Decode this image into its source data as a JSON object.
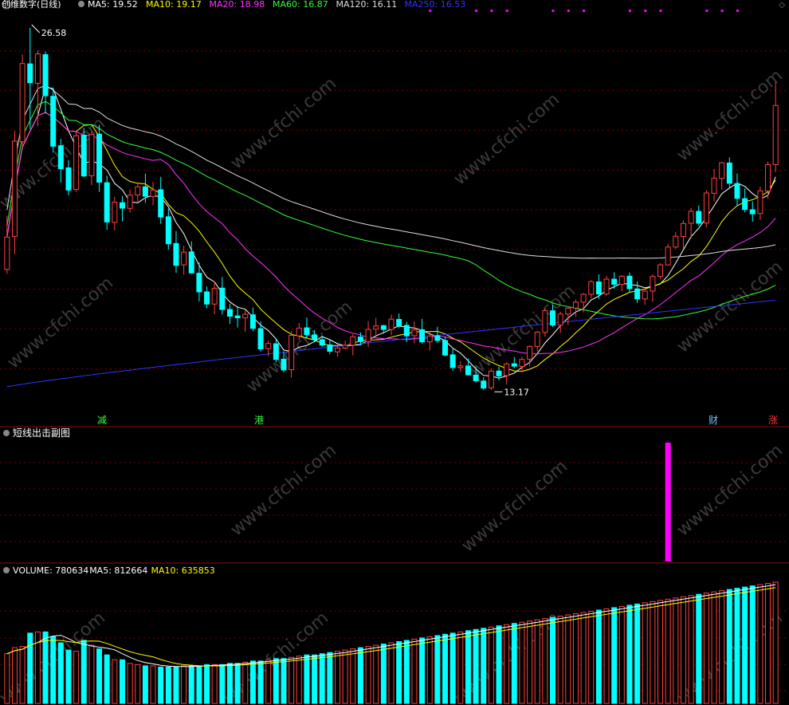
{
  "main_panel": {
    "title": "创维数字(日线)",
    "legend": [
      {
        "label": "MA5: 19.52",
        "color": "#ffffff"
      },
      {
        "label": "MA10: 19.17",
        "color": "#ffff00"
      },
      {
        "label": "MA20: 18.98",
        "color": "#ff33ff"
      },
      {
        "label": "MA60: 16.87",
        "color": "#33ff33"
      },
      {
        "label": "MA120: 16.11",
        "color": "#dddddd"
      },
      {
        "label": "MA250: 16.53",
        "color": "#3333ff"
      }
    ],
    "high_label": "26.58",
    "low_label": "13.17",
    "markers": [
      {
        "text": "减",
        "color": "#33ff33"
      },
      {
        "text": "港",
        "color": "#33ff33"
      },
      {
        "text": "财",
        "color": "#66ccff"
      },
      {
        "text": "涨",
        "color": "#ff3333"
      }
    ]
  },
  "sub_panel": {
    "title": "短线出击副图"
  },
  "volume_panel": {
    "legend": [
      {
        "label": "VOLUME: 780634",
        "color": "#ffffff"
      },
      {
        "label": "MA5: 812664",
        "color": "#ffffff"
      },
      {
        "label": "MA10: 635853",
        "color": "#ffff00"
      }
    ]
  },
  "colors": {
    "up": "#ff4040",
    "down": "#00ffff",
    "signal": "#ff00ff",
    "grid": "#7a0000",
    "separator": "#8a1010"
  },
  "watermark": "www.cfchi.com",
  "chart_data": {
    "type": "candlestick",
    "ylim": [
      12.5,
      27.2
    ],
    "ohlc": [
      [
        17.64,
        19.63,
        17.48,
        18.84
      ],
      [
        18.86,
        22.76,
        18.21,
        22.39
      ],
      [
        22.37,
        25.59,
        22.19,
        25.26
      ],
      [
        25.25,
        26.58,
        22.84,
        24.55
      ],
      [
        24.53,
        25.75,
        22.94,
        25.62
      ],
      [
        25.59,
        25.71,
        23.41,
        24.07
      ],
      [
        24.05,
        24.37,
        21.97,
        22.2
      ],
      [
        22.22,
        22.47,
        20.86,
        21.37
      ],
      [
        21.4,
        21.69,
        20.38,
        20.58
      ],
      [
        20.6,
        22.74,
        20.51,
        22.59
      ],
      [
        22.61,
        22.88,
        21.05,
        21.1
      ],
      [
        21.11,
        22.75,
        20.76,
        22.63
      ],
      [
        22.65,
        22.99,
        20.51,
        20.87
      ],
      [
        20.85,
        21.11,
        19.11,
        19.4
      ],
      [
        19.38,
        20.33,
        19.09,
        20.13
      ],
      [
        20.11,
        20.36,
        19.42,
        19.91
      ],
      [
        19.9,
        20.6,
        19.75,
        20.39
      ],
      [
        20.4,
        20.8,
        20.09,
        20.7
      ],
      [
        20.7,
        21.19,
        20.1,
        20.35
      ],
      [
        20.34,
        20.88,
        20.01,
        20.58
      ],
      [
        20.59,
        21.07,
        19.33,
        19.58
      ],
      [
        19.59,
        19.89,
        18.38,
        18.59
      ],
      [
        18.6,
        19.06,
        17.52,
        17.79
      ],
      [
        17.81,
        18.52,
        17.45,
        18.28
      ],
      [
        18.29,
        18.68,
        17.48,
        17.51
      ],
      [
        17.5,
        17.9,
        16.46,
        16.81
      ],
      [
        16.81,
        17.01,
        16.2,
        16.36
      ],
      [
        16.36,
        17.2,
        15.98,
        16.94
      ],
      [
        16.95,
        17.36,
        15.97,
        16.16
      ],
      [
        16.16,
        16.37,
        15.63,
        15.91
      ],
      [
        15.92,
        16.28,
        15.49,
        15.85
      ],
      [
        15.85,
        16.15,
        15.33,
        15.98
      ],
      [
        15.96,
        16.23,
        15.35,
        15.46
      ],
      [
        15.45,
        15.72,
        14.6,
        14.7
      ],
      [
        14.71,
        15.01,
        14.43,
        14.9
      ],
      [
        14.89,
        15.06,
        14.21,
        14.31
      ],
      [
        14.32,
        14.61,
        13.84,
        13.92
      ],
      [
        13.93,
        15.36,
        13.64,
        15.2
      ],
      [
        15.18,
        15.66,
        15.02,
        15.47
      ],
      [
        15.48,
        15.86,
        15.09,
        15.23
      ],
      [
        15.22,
        15.4,
        14.98,
        15.04
      ],
      [
        15.04,
        15.2,
        14.77,
        14.84
      ],
      [
        14.85,
        15.07,
        14.51,
        14.61
      ],
      [
        14.59,
        14.86,
        14.42,
        14.73
      ],
      [
        14.73,
        15.01,
        14.68,
        14.83
      ],
      [
        14.84,
        15.24,
        14.46,
        15.15
      ],
      [
        15.14,
        15.31,
        14.84,
        14.97
      ],
      [
        14.97,
        15.73,
        14.77,
        15.42
      ],
      [
        15.43,
        15.85,
        15.1,
        15.55
      ],
      [
        15.56,
        15.59,
        15.26,
        15.42
      ],
      [
        15.42,
        15.97,
        15.21,
        15.8
      ],
      [
        15.79,
        16.01,
        15.47,
        15.56
      ],
      [
        15.57,
        15.7,
        14.95,
        15.18
      ],
      [
        15.19,
        15.72,
        14.91,
        15.4
      ],
      [
        15.41,
        15.81,
        14.89,
        14.96
      ],
      [
        14.96,
        15.31,
        14.64,
        15.18
      ],
      [
        15.19,
        15.52,
        14.92,
        15.01
      ],
      [
        15.01,
        15.16,
        14.43,
        14.47
      ],
      [
        14.48,
        14.69,
        13.89,
        14.01
      ],
      [
        14.01,
        14.24,
        13.85,
        14.07
      ],
      [
        14.07,
        14.35,
        13.72,
        13.74
      ],
      [
        13.73,
        14.02,
        13.46,
        13.52
      ],
      [
        13.51,
        13.65,
        13.18,
        13.25
      ],
      [
        13.26,
        13.97,
        13.17,
        13.88
      ],
      [
        13.88,
        14.04,
        13.53,
        13.7
      ],
      [
        13.71,
        14.21,
        13.38,
        14.14
      ],
      [
        14.15,
        14.4,
        13.98,
        14.06
      ],
      [
        14.05,
        14.4,
        13.84,
        14.31
      ],
      [
        14.32,
        14.83,
        14.05,
        14.79
      ],
      [
        14.79,
        15.36,
        14.62,
        15.32
      ],
      [
        15.31,
        16.21,
        15.15,
        16.12
      ],
      [
        16.11,
        16.33,
        15.51,
        15.58
      ],
      [
        15.58,
        16.07,
        15.29,
        15.99
      ],
      [
        15.99,
        16.28,
        15.58,
        16.21
      ],
      [
        16.21,
        16.53,
        15.88,
        16.43
      ],
      [
        16.43,
        16.77,
        16.05,
        16.72
      ],
      [
        16.72,
        17.24,
        16.58,
        17.19
      ],
      [
        17.18,
        17.46,
        16.55,
        16.73
      ],
      [
        16.73,
        17.4,
        16.66,
        17.28
      ],
      [
        17.28,
        17.54,
        16.92,
        17.09
      ],
      [
        17.09,
        17.43,
        16.83,
        17.39
      ],
      [
        17.39,
        17.53,
        16.79,
        16.93
      ],
      [
        16.92,
        17.19,
        16.4,
        16.55
      ],
      [
        16.55,
        16.95,
        16.33,
        16.84
      ],
      [
        16.84,
        17.46,
        16.44,
        17.38
      ],
      [
        17.38,
        17.87,
        17.29,
        17.81
      ],
      [
        17.81,
        18.59,
        17.79,
        18.47
      ],
      [
        18.47,
        19.02,
        18.4,
        18.87
      ],
      [
        18.86,
        19.46,
        18.4,
        19.34
      ],
      [
        19.35,
        19.91,
        18.79,
        19.79
      ],
      [
        19.79,
        20.01,
        19.26,
        19.35
      ],
      [
        19.36,
        20.57,
        19.2,
        20.47
      ],
      [
        20.46,
        21.36,
        20.16,
        21.02
      ],
      [
        21.01,
        21.62,
        20.59,
        21.59
      ],
      [
        21.58,
        21.79,
        20.67,
        20.83
      ],
      [
        20.82,
        21.19,
        19.97,
        20.27
      ],
      [
        20.26,
        20.64,
        19.75,
        19.86
      ],
      [
        19.85,
        20.16,
        19.41,
        19.7
      ],
      [
        19.71,
        20.71,
        19.48,
        20.55
      ],
      [
        20.54,
        21.64,
        20.25,
        21.52
      ],
      [
        21.52,
        24.58,
        21.24,
        23.71
      ]
    ],
    "volume": [
      41,
      46,
      47,
      58,
      59,
      59,
      55,
      50,
      44,
      43,
      52,
      48,
      45,
      40,
      36,
      36,
      33,
      32,
      31,
      31,
      30,
      30,
      30,
      31,
      31,
      31,
      32,
      32,
      32,
      33,
      33,
      34,
      35,
      35,
      36,
      37,
      37,
      38,
      39,
      40,
      40,
      41,
      42,
      43,
      44,
      45,
      46,
      47,
      48,
      49,
      50,
      51,
      52,
      53,
      54,
      55,
      56,
      57,
      58,
      59,
      60,
      61,
      62,
      63,
      64,
      65,
      66,
      67,
      68,
      69,
      70,
      71,
      72,
      73,
      74,
      75,
      76,
      77,
      78,
      79,
      80,
      81,
      82,
      83,
      84,
      85,
      86,
      87,
      88,
      89,
      90,
      91,
      92,
      93,
      94,
      95,
      96,
      97,
      98,
      99,
      100
    ],
    "signal_bar_index": 86
  }
}
